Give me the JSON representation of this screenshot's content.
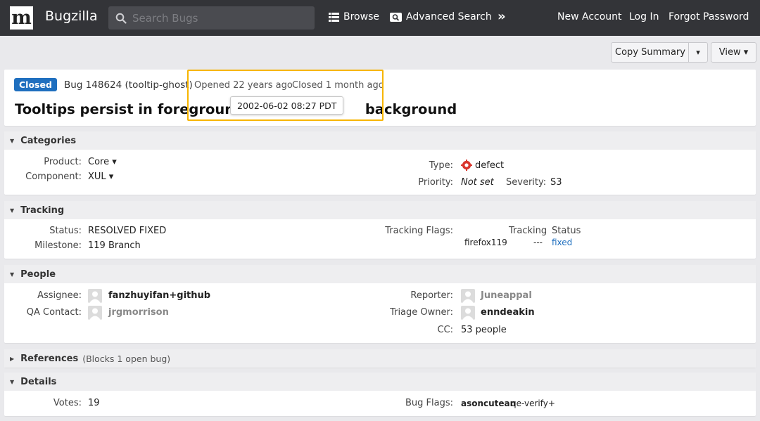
{
  "header": {
    "logo": "m",
    "app_name": "Bugzilla",
    "search_placeholder": "Search Bugs",
    "browse": "Browse",
    "advanced_search": "Advanced Search",
    "more": "»",
    "new_account": "New Account",
    "log_in": "Log In",
    "forgot_password": "Forgot Password"
  },
  "toolbar": {
    "copy_summary": "Copy Summary",
    "copy_menu": "▾",
    "view": "View ▾"
  },
  "summary": {
    "status_badge": "Closed",
    "bug_id": "Bug 148624 (tooltip-ghost)",
    "opened": "Opened 22 years ago",
    "closed": "Closed 1 month ago",
    "title_left": "Tooltips persist in foreground wh",
    "title_right": "background",
    "tooltip": "2002-06-02 08:27 PDT"
  },
  "categories": {
    "heading": "Categories",
    "product_label": "Product:",
    "product_value": "Core ▾",
    "component_label": "Component:",
    "component_value": "XUL ▾",
    "type_label": "Type:",
    "type_value": "defect",
    "priority_label": "Priority:",
    "priority_value": "Not set",
    "severity_label": "Severity:",
    "severity_value": "S3"
  },
  "tracking": {
    "heading": "Tracking",
    "status_label": "Status:",
    "status_value": "RESOLVED FIXED",
    "milestone_label": "Milestone:",
    "milestone_value": "119 Branch",
    "flags_label": "Tracking Flags:",
    "col_tracking": "Tracking",
    "col_status": "Status",
    "flag_name": "firefox119",
    "flag_tracking": "---",
    "flag_status": "fixed"
  },
  "people": {
    "heading": "People",
    "assignee_label": "Assignee:",
    "assignee_value": "fanzhuyifan+github",
    "qa_label": "QA Contact:",
    "qa_value": "jrgmorrison",
    "reporter_label": "Reporter:",
    "reporter_value": "Juneappal",
    "triage_label": "Triage Owner:",
    "triage_value": "enndeakin",
    "cc_label": "CC:",
    "cc_value": "53 people"
  },
  "references": {
    "heading": "References",
    "subtitle": "(Blocks 1 open bug)"
  },
  "details": {
    "heading": "Details",
    "votes_label": "Votes:",
    "votes_value": "19",
    "flags_label": "Bug Flags:",
    "flag_setter": "asoncutean",
    "flag_value": "qe-verify+"
  },
  "colors": {
    "header_bg": "#333438",
    "accent": "#1f6fbf",
    "highlight": "#f7b500",
    "defect_icon": "#d9352c"
  }
}
